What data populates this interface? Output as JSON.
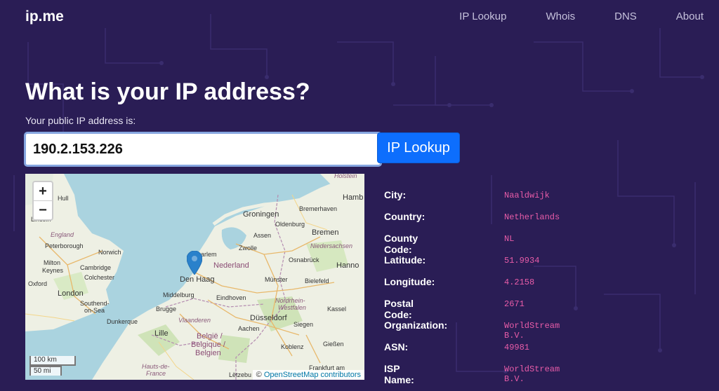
{
  "brand": "ip.me",
  "nav": [
    "IP Lookup",
    "Whois",
    "DNS",
    "About"
  ],
  "hero": {
    "title": "What is your IP address?",
    "subtitle": "Your public IP address is:",
    "ip_value": "190.2.153.226",
    "button_label": "IP Lookup"
  },
  "map": {
    "zoom_in": "+",
    "zoom_out": "−",
    "scale_km": "100 km",
    "scale_mi": "50 mi",
    "attribution_prefix": "©",
    "attribution_link": "OpenStreetMap contributors",
    "labels": {
      "hull": "Hull",
      "lincoln": "Lincoln",
      "england": "England",
      "peterborough": "Peterborough",
      "norwich": "Norwich",
      "milton": "Milton",
      "keynes": "Keynes",
      "cambridge": "Cambridge",
      "colchester": "Colchester",
      "oxford": "Oxford",
      "london": "London",
      "southend": "Southend-",
      "onsea": "on-Sea",
      "dunkerque": "Dunkerque",
      "lille": "Lille",
      "hauts": "Hauts-de-",
      "france": "France",
      "groningen": "Groningen",
      "bremerhaven": "Bremerhaven",
      "hamb": "Hamb",
      "oldenburg": "Oldenburg",
      "bremen": "Bremen",
      "assen": "Assen",
      "niedersachsen": "Niedersachsen",
      "zwolle": "Zwolle",
      "haarlem": "arlem",
      "nederland": "Nederland",
      "osnabruck": "Osnabrück",
      "hanno": "Hanno",
      "denhaag": "Den Haag",
      "munster": "Münster",
      "bielefeld": "Bielefeld",
      "middelburg": "Middelburg",
      "eindhoven": "Eindhoven",
      "brugge": "Brugge",
      "nordrhein": "Nordrhein-",
      "westfalen": "Westfalen",
      "kassel": "Kassel",
      "vlaanderen": "Vlaanderen",
      "dusseldorf": "Düsseldorf",
      "aachen": "Aachen",
      "siegen": "Siegen",
      "belgie": "België /",
      "belgique": "Belgique /",
      "belgien": "Belgien",
      "koblenz": "Koblenz",
      "frankfurt": "Frankfurt am",
      "letzebu": "Lëtzebu",
      "giessen": "Gießen",
      "hilstein": "Holstein"
    }
  },
  "info": [
    {
      "key": "City:",
      "value": "Naaldwijk"
    },
    {
      "key": "Country:",
      "value": "Netherlands"
    },
    {
      "key": "County Code:",
      "value": "NL"
    },
    {
      "key": "Latitude:",
      "value": "51.9934"
    },
    {
      "key": "Longitude:",
      "value": "4.2158"
    },
    {
      "key": "Postal Code:",
      "value": "2671"
    },
    {
      "key": "Organization:",
      "value": "WorldStream B.V."
    },
    {
      "key": "ASN:",
      "value": "49981"
    },
    {
      "key": "ISP Name:",
      "value": "WorldStream B.V."
    }
  ],
  "colors": {
    "background": "#2a1d55",
    "accent_button": "#0d6efd",
    "value_text": "#e85ca8"
  }
}
